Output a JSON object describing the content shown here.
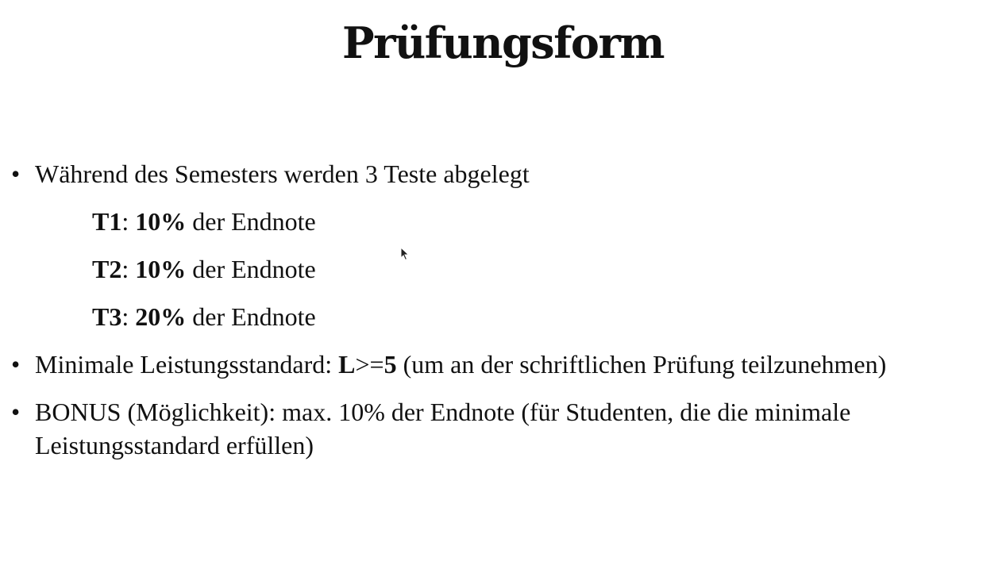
{
  "title": "Prüfungsform",
  "bullets": [
    {
      "text": "Während des Semesters werden 3 Teste abgelegt",
      "subitems": [
        {
          "label": "T1",
          "sep": ": ",
          "percent": "10%",
          "rest": " der Endnote"
        },
        {
          "label": "T2",
          "sep": ": ",
          "percent": "10%",
          "rest": " der Endnote"
        },
        {
          "label": "T3",
          "sep": ": ",
          "percent": "20%",
          "rest": " der Endnote"
        }
      ]
    },
    {
      "prefix": "Minimale Leistungsstandard: ",
      "bold1": "L",
      "mid": ">=",
      "bold2": "5",
      "suffix": " (um an der schriftlichen Prüfung teilzunehmen)"
    },
    {
      "line1": "BONUS (Möglichkeit): max. 10% der Endnote (für Studenten, die die minimale",
      "line2": "Leistungsstandard erfüllen)"
    }
  ],
  "bullet_char": "•"
}
